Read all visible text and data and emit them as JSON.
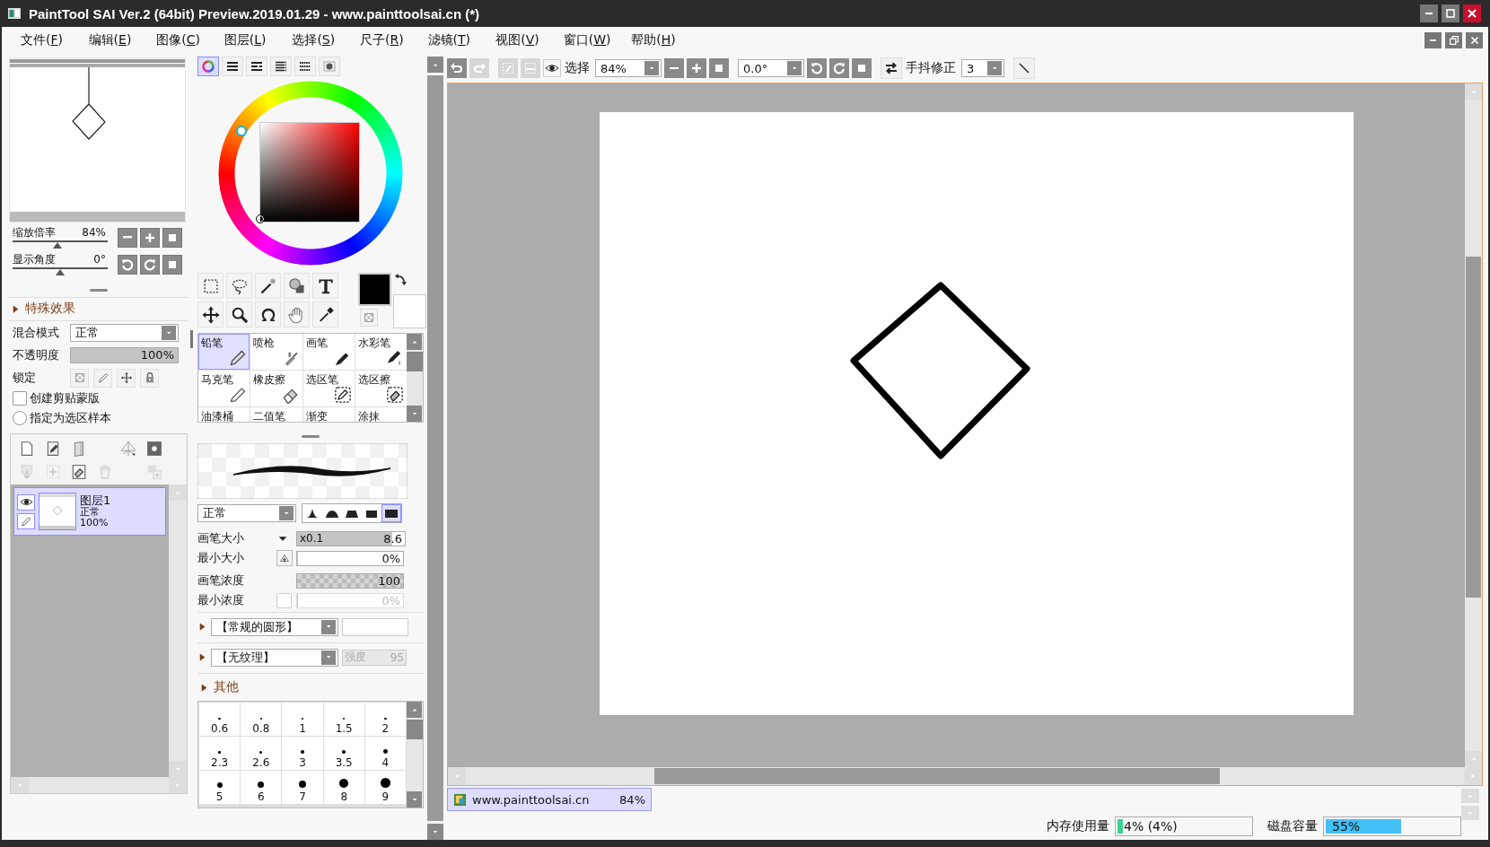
{
  "window": {
    "title": "PaintTool SAI Ver.2 (64bit) Preview.2019.01.29 - www.painttoolsai.cn (*)"
  },
  "menu": [
    {
      "text": "文件(",
      "mnemonic": "F",
      "close": ")"
    },
    {
      "text": "编辑(",
      "mnemonic": "E",
      "close": ")"
    },
    {
      "text": "图像(",
      "mnemonic": "C",
      "close": ")"
    },
    {
      "text": "图层(",
      "mnemonic": "L",
      "close": ")"
    },
    {
      "text": "选择(",
      "mnemonic": "S",
      "close": ")"
    },
    {
      "text": "尺子(",
      "mnemonic": "R",
      "close": ")"
    },
    {
      "text": "滤镜(",
      "mnemonic": "T",
      "close": ")"
    },
    {
      "text": "视图(",
      "mnemonic": "V",
      "close": ")"
    },
    {
      "text": "窗口(",
      "mnemonic": "W",
      "close": ")"
    },
    {
      "text": "帮助(",
      "mnemonic": "H",
      "close": ")"
    }
  ],
  "navigator": {
    "zoom": {
      "label": "缩放倍率",
      "value": "84%",
      "level": 0.47
    },
    "angle": {
      "label": "显示角度",
      "value": "0°",
      "level": 0.5
    }
  },
  "layer_properties": {
    "section": {
      "label": "特殊效果",
      "expanded": false
    },
    "blend_mode": {
      "label": "混合模式",
      "value": "正常"
    },
    "opacity": {
      "label": "不透明度",
      "value": "100%",
      "level": 1
    },
    "lock": {
      "label": "锁定"
    },
    "clipping": {
      "label": "创建剪贴蒙版",
      "checked": false
    },
    "selection_source": {
      "label": "指定为选区样本",
      "selected": false
    }
  },
  "layer_buttons": [
    {
      "disabled": false
    },
    {
      "disabled": false
    },
    {
      "disabled": false
    },
    {
      "disabled": false
    },
    {
      "disabled": false
    },
    {
      "disabled": true
    },
    {
      "disabled": true
    },
    {
      "disabled": false
    },
    {
      "disabled": true
    },
    {
      "disabled": true
    }
  ],
  "layers": [
    {
      "name": "图层1",
      "mode": "正常",
      "opacity": "100%",
      "selected": true,
      "visible": true
    }
  ],
  "color_tabs": [
    {
      "selected": true
    },
    {
      "selected": false
    },
    {
      "selected": false
    },
    {
      "selected": false
    },
    {
      "selected": false
    },
    {
      "selected": false
    }
  ],
  "brush_tools": [
    {
      "label": "铅笔",
      "selected": true
    },
    {
      "label": "喷枪",
      "selected": false
    },
    {
      "label": "画笔",
      "selected": false
    },
    {
      "label": "水彩笔",
      "selected": false
    },
    {
      "label": "马克笔",
      "selected": false
    },
    {
      "label": "橡皮擦",
      "selected": false
    },
    {
      "label": "选区笔",
      "selected": false
    },
    {
      "label": "选区擦",
      "selected": false
    },
    {
      "label": "油漆桶",
      "selected": false
    },
    {
      "label": "二值笔",
      "selected": false
    },
    {
      "label": "渐变",
      "selected": false
    },
    {
      "label": "涂抹",
      "selected": false
    }
  ],
  "brush_mode": {
    "value": "正常"
  },
  "brush_shapes": [
    {
      "selected": false
    },
    {
      "selected": false
    },
    {
      "selected": false
    },
    {
      "selected": false
    },
    {
      "selected": true
    }
  ],
  "brush_params": [
    {
      "kind": "size",
      "label": "画笔大小",
      "prefix": "x0.1",
      "value": "8.6",
      "level": 0.88
    },
    {
      "kind": "min-size",
      "label": "最小大小",
      "value": "0%",
      "level": 0
    },
    {
      "kind": "density",
      "label": "画笔浓度",
      "value": "100",
      "level": 1
    },
    {
      "kind": "min-density",
      "label": "最小浓度",
      "value": "0%",
      "level": 0,
      "disabled": true
    }
  ],
  "shape_select": {
    "value": "【常规的圆形】",
    "expanded": false
  },
  "texture_select": {
    "value": "【无纹理】",
    "expanded": false,
    "strength_label": "强度",
    "strength": "95",
    "disabled": true
  },
  "other": {
    "label": "其他",
    "expanded": false
  },
  "brush_sizes": [
    "0.6",
    "0.8",
    "1",
    "1.5",
    "2",
    "2.3",
    "2.6",
    "3",
    "3.5",
    "4",
    "5",
    "6",
    "7",
    "8",
    "9"
  ],
  "toolbar": {
    "history": [
      {
        "disabled": false
      },
      {
        "disabled": true
      }
    ],
    "selection": [
      {
        "disabled": true
      },
      {
        "disabled": true
      }
    ],
    "show_selection": {
      "label": "选择"
    },
    "zoom": "84%",
    "angle": "0.0°",
    "stabilizer": {
      "label": "手抖修正",
      "value": "3"
    }
  },
  "document_tabs": [
    {
      "title": "www.painttoolsai.cn",
      "zoom": "84%",
      "selected": true
    }
  ],
  "status_bar": {
    "memory": {
      "label": "内存使用量",
      "value": "4% (4%)",
      "level": 0.04
    },
    "disk": {
      "label": "磁盘容量",
      "value": "55%",
      "level": 0.55
    }
  }
}
